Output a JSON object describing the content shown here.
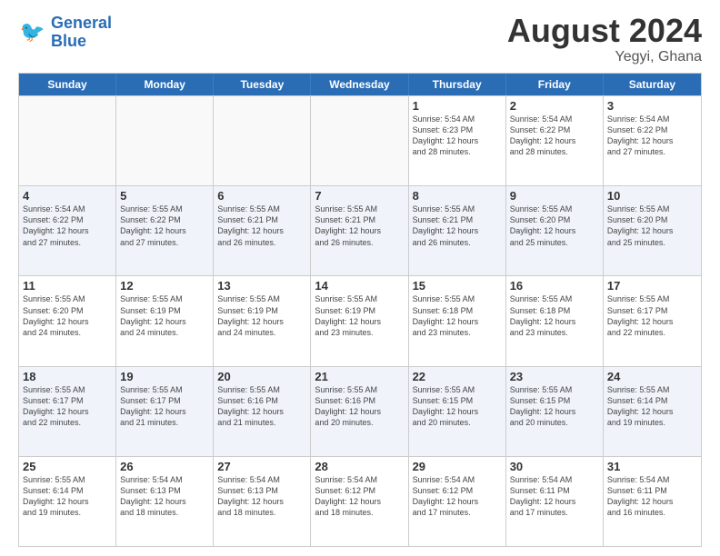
{
  "logo": {
    "line1": "General",
    "line2": "Blue"
  },
  "title": "August 2024",
  "location": "Yegyi, Ghana",
  "days": [
    "Sunday",
    "Monday",
    "Tuesday",
    "Wednesday",
    "Thursday",
    "Friday",
    "Saturday"
  ],
  "weeks": [
    [
      {
        "date": "",
        "info": ""
      },
      {
        "date": "",
        "info": ""
      },
      {
        "date": "",
        "info": ""
      },
      {
        "date": "",
        "info": ""
      },
      {
        "date": "1",
        "info": "Sunrise: 5:54 AM\nSunset: 6:23 PM\nDaylight: 12 hours\nand 28 minutes."
      },
      {
        "date": "2",
        "info": "Sunrise: 5:54 AM\nSunset: 6:22 PM\nDaylight: 12 hours\nand 28 minutes."
      },
      {
        "date": "3",
        "info": "Sunrise: 5:54 AM\nSunset: 6:22 PM\nDaylight: 12 hours\nand 27 minutes."
      }
    ],
    [
      {
        "date": "4",
        "info": "Sunrise: 5:54 AM\nSunset: 6:22 PM\nDaylight: 12 hours\nand 27 minutes."
      },
      {
        "date": "5",
        "info": "Sunrise: 5:55 AM\nSunset: 6:22 PM\nDaylight: 12 hours\nand 27 minutes."
      },
      {
        "date": "6",
        "info": "Sunrise: 5:55 AM\nSunset: 6:21 PM\nDaylight: 12 hours\nand 26 minutes."
      },
      {
        "date": "7",
        "info": "Sunrise: 5:55 AM\nSunset: 6:21 PM\nDaylight: 12 hours\nand 26 minutes."
      },
      {
        "date": "8",
        "info": "Sunrise: 5:55 AM\nSunset: 6:21 PM\nDaylight: 12 hours\nand 26 minutes."
      },
      {
        "date": "9",
        "info": "Sunrise: 5:55 AM\nSunset: 6:20 PM\nDaylight: 12 hours\nand 25 minutes."
      },
      {
        "date": "10",
        "info": "Sunrise: 5:55 AM\nSunset: 6:20 PM\nDaylight: 12 hours\nand 25 minutes."
      }
    ],
    [
      {
        "date": "11",
        "info": "Sunrise: 5:55 AM\nSunset: 6:20 PM\nDaylight: 12 hours\nand 24 minutes."
      },
      {
        "date": "12",
        "info": "Sunrise: 5:55 AM\nSunset: 6:19 PM\nDaylight: 12 hours\nand 24 minutes."
      },
      {
        "date": "13",
        "info": "Sunrise: 5:55 AM\nSunset: 6:19 PM\nDaylight: 12 hours\nand 24 minutes."
      },
      {
        "date": "14",
        "info": "Sunrise: 5:55 AM\nSunset: 6:19 PM\nDaylight: 12 hours\nand 23 minutes."
      },
      {
        "date": "15",
        "info": "Sunrise: 5:55 AM\nSunset: 6:18 PM\nDaylight: 12 hours\nand 23 minutes."
      },
      {
        "date": "16",
        "info": "Sunrise: 5:55 AM\nSunset: 6:18 PM\nDaylight: 12 hours\nand 23 minutes."
      },
      {
        "date": "17",
        "info": "Sunrise: 5:55 AM\nSunset: 6:17 PM\nDaylight: 12 hours\nand 22 minutes."
      }
    ],
    [
      {
        "date": "18",
        "info": "Sunrise: 5:55 AM\nSunset: 6:17 PM\nDaylight: 12 hours\nand 22 minutes."
      },
      {
        "date": "19",
        "info": "Sunrise: 5:55 AM\nSunset: 6:17 PM\nDaylight: 12 hours\nand 21 minutes."
      },
      {
        "date": "20",
        "info": "Sunrise: 5:55 AM\nSunset: 6:16 PM\nDaylight: 12 hours\nand 21 minutes."
      },
      {
        "date": "21",
        "info": "Sunrise: 5:55 AM\nSunset: 6:16 PM\nDaylight: 12 hours\nand 20 minutes."
      },
      {
        "date": "22",
        "info": "Sunrise: 5:55 AM\nSunset: 6:15 PM\nDaylight: 12 hours\nand 20 minutes."
      },
      {
        "date": "23",
        "info": "Sunrise: 5:55 AM\nSunset: 6:15 PM\nDaylight: 12 hours\nand 20 minutes."
      },
      {
        "date": "24",
        "info": "Sunrise: 5:55 AM\nSunset: 6:14 PM\nDaylight: 12 hours\nand 19 minutes."
      }
    ],
    [
      {
        "date": "25",
        "info": "Sunrise: 5:55 AM\nSunset: 6:14 PM\nDaylight: 12 hours\nand 19 minutes."
      },
      {
        "date": "26",
        "info": "Sunrise: 5:54 AM\nSunset: 6:13 PM\nDaylight: 12 hours\nand 18 minutes."
      },
      {
        "date": "27",
        "info": "Sunrise: 5:54 AM\nSunset: 6:13 PM\nDaylight: 12 hours\nand 18 minutes."
      },
      {
        "date": "28",
        "info": "Sunrise: 5:54 AM\nSunset: 6:12 PM\nDaylight: 12 hours\nand 18 minutes."
      },
      {
        "date": "29",
        "info": "Sunrise: 5:54 AM\nSunset: 6:12 PM\nDaylight: 12 hours\nand 17 minutes."
      },
      {
        "date": "30",
        "info": "Sunrise: 5:54 AM\nSunset: 6:11 PM\nDaylight: 12 hours\nand 17 minutes."
      },
      {
        "date": "31",
        "info": "Sunrise: 5:54 AM\nSunset: 6:11 PM\nDaylight: 12 hours\nand 16 minutes."
      }
    ]
  ]
}
